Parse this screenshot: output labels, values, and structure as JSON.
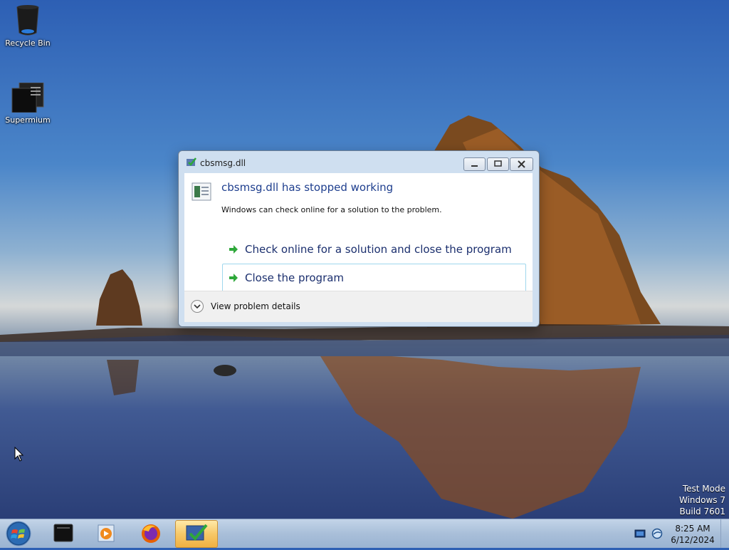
{
  "desktop": {
    "icons": [
      {
        "label": "Recycle Bin",
        "icon": "recycle-bin-icon"
      },
      {
        "label": "Supermium",
        "icon": "supermium-icon"
      }
    ],
    "watermark": [
      "Test Mode",
      "Windows 7",
      "Build 7601"
    ]
  },
  "dialog": {
    "title": "cbsmsg.dll",
    "heading": "cbsmsg.dll has stopped working",
    "message": "Windows can check online for a solution to the problem.",
    "options": [
      {
        "label": "Check online for a solution and close the program"
      },
      {
        "label": "Close the program"
      }
    ],
    "details_label": "View problem details"
  },
  "taskbar": {
    "items": [
      "terminal-icon",
      "media-player-icon",
      "firefox-icon",
      "error-reporting-icon"
    ],
    "time": "8:25 AM",
    "date": "6/12/2024"
  },
  "colors": {
    "heading": "#1e3e8e",
    "command_link": "#1b2f6e",
    "arrow": "#2ea83a",
    "taskbar_active": "#f7c868"
  }
}
